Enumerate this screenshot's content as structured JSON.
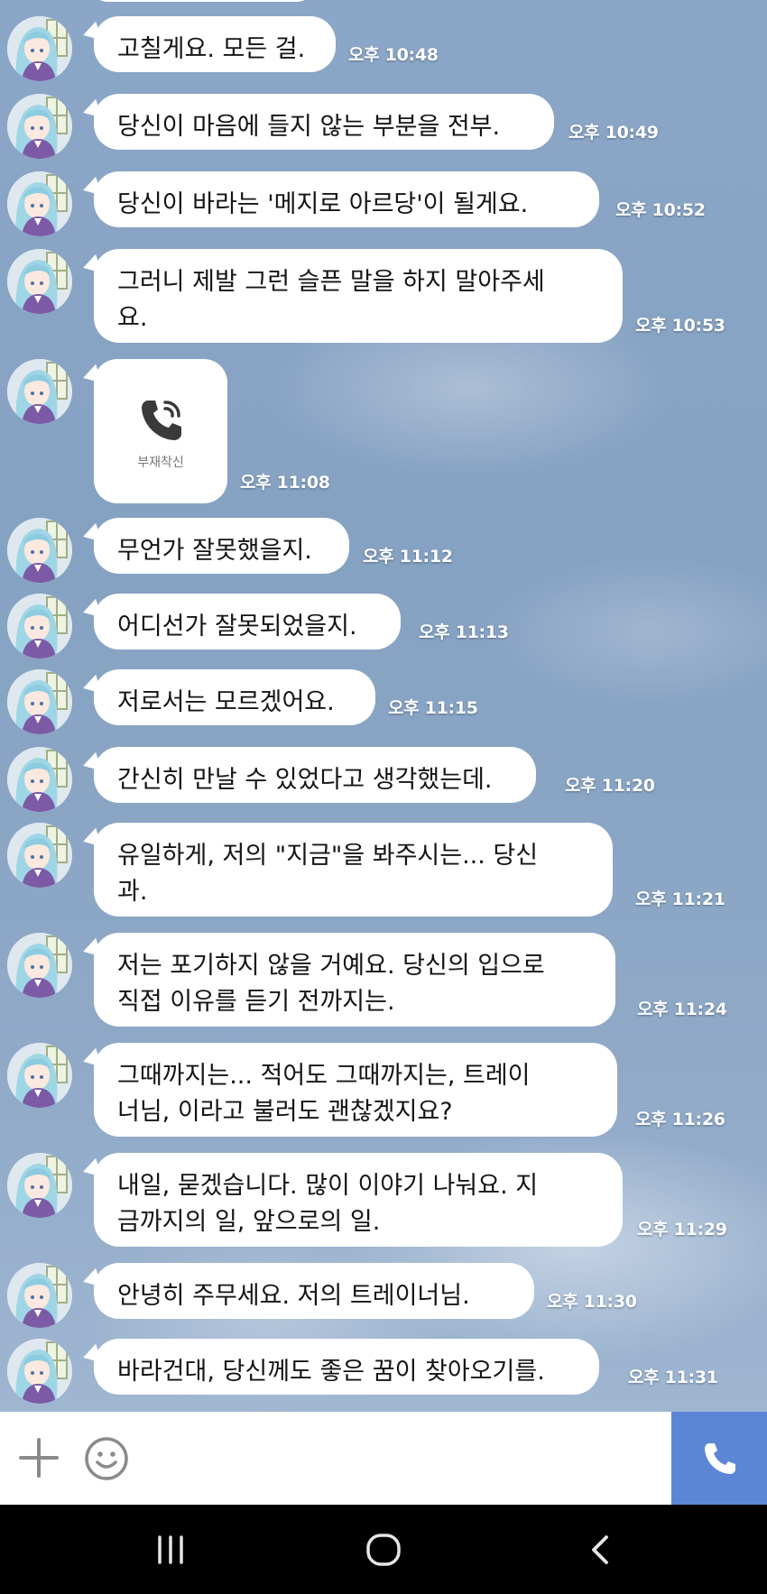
{
  "chat": {
    "messages": [
      {
        "type": "text",
        "text": "고칠게요. 모든 걸.",
        "time": "오후 10:48"
      },
      {
        "type": "text",
        "text": "당신이 마음에 들지 않는 부분을 전부.",
        "time": "오후 10:49"
      },
      {
        "type": "text",
        "text": "당신이 바라는 '메지로 아르당'이 될게요.",
        "time": "오후 10:52"
      },
      {
        "type": "text",
        "text": "그러니 제발 그런 슬픈 말을 하지 말아주세\n요.",
        "time": "오후 10:53"
      },
      {
        "type": "call",
        "label": "부재착신",
        "icon": "phone-icon",
        "time": "오후 11:08"
      },
      {
        "type": "text",
        "text": "무언가 잘못했을지.",
        "time": "오후 11:12"
      },
      {
        "type": "text",
        "text": "어디선가 잘못되었을지.",
        "time": "오후 11:13"
      },
      {
        "type": "text",
        "text": "저로서는 모르겠어요.",
        "time": "오후 11:15"
      },
      {
        "type": "text",
        "text": "간신히 만날 수 있었다고 생각했는데.",
        "time": "오후 11:20"
      },
      {
        "type": "text",
        "text": "유일하게, 저의 \"지금\"을 봐주시는... 당신\n과.",
        "time": "오후 11:21"
      },
      {
        "type": "text",
        "text": "저는 포기하지 않을 거예요. 당신의 입으로\n직접 이유를 듣기 전까지는.",
        "time": "오후 11:24"
      },
      {
        "type": "text",
        "text": "그때까지는... 적어도 그때까지는, 트레이\n너님, 이라고 불러도 괜찮겠지요?",
        "time": "오후 11:26"
      },
      {
        "type": "text",
        "text": "내일, 묻겠습니다. 많이 이야기 나눠요. 지\n금까지의 일, 앞으로의 일.",
        "time": "오후 11:29"
      },
      {
        "type": "text",
        "text": "안녕히 주무세요. 저의 트레이너님.",
        "time": "오후 11:30"
      },
      {
        "type": "text",
        "text": "바라건대, 당신께도 좋은 꿈이 찾아오기를.",
        "time": "오후 11:31"
      }
    ]
  },
  "input_bar": {
    "plus_icon": "plus-icon",
    "emoji_icon": "smiley-icon",
    "call_icon": "phone-icon",
    "call_color": "#5b86d6"
  },
  "nav_bar": {
    "recent_icon": "recent-apps-icon",
    "home_icon": "home-icon",
    "back_icon": "back-icon"
  }
}
